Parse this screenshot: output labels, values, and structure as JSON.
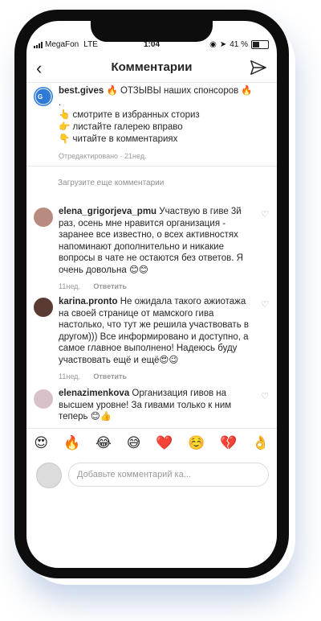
{
  "status": {
    "carrier": "MegaFon",
    "network": "LTE",
    "time": "1:04",
    "battery": "41 %"
  },
  "header": {
    "title": "Комментарии"
  },
  "post": {
    "username": "best.gives",
    "line1": "🔥 ОТЗЫВЫ наших спонсоров 🔥",
    "line2": ".",
    "line3": "👆 смотрите в избранных сториз",
    "line4": "👉 листайте галерею вправо",
    "line5": "👇 читайте в комментариях",
    "meta": "Отредактировано · 21нед."
  },
  "load_more": "Загрузите еще комментарии",
  "comments": [
    {
      "username": "elena_grigorjeva_pmu",
      "text": "Участвую в гиве 3й раз, осень мне нравится организация - заранее все известно, о всех активностях напоминают дополнительно и никакие вопросы в чате не остаются без ответов. Я очень довольна 😊😊",
      "time": "11нед.",
      "reply": "Ответить"
    },
    {
      "username": "karina.pronto",
      "text": "Не ожидала такого ажиотажа на своей странице от мамского гива настолько, что тут же решила участвовать в другом))) Все информировано и доступно, а самое главное выполнено! Надеюсь буду участвовать ещё и ещё😍😉",
      "time": "11нед.",
      "reply": "Ответить"
    },
    {
      "username": "elenazimenkova",
      "text": "Организация гивов на высшем уровне! За гивами только к ним теперь 😊👍",
      "time": "",
      "reply": ""
    }
  ],
  "emojis": [
    "😍",
    "🔥",
    "😂",
    "😅",
    "❤️",
    "☺️",
    "💔",
    "👌"
  ],
  "composer": {
    "placeholder": "Добавьте комментарий ка..."
  },
  "colors": {
    "accent": "#2e7bd6",
    "muted": "#8e8e8e"
  }
}
